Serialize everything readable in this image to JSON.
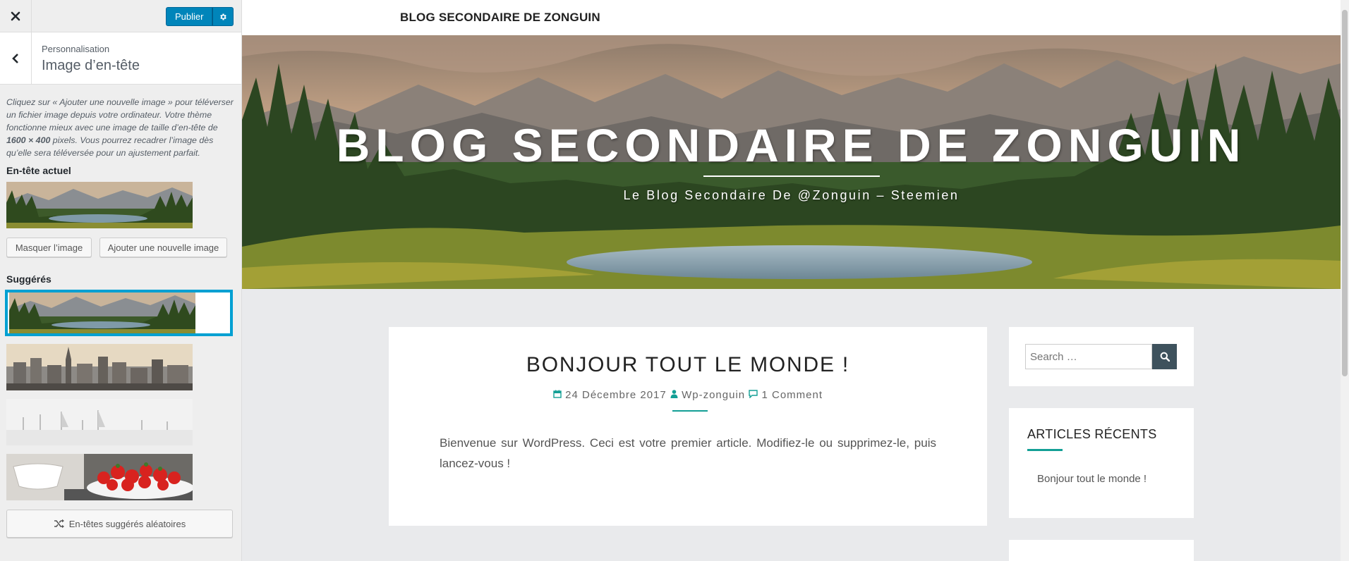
{
  "customizer": {
    "close_icon": "close-icon",
    "publish_label": "Publier",
    "settings_icon": "gear-icon",
    "back_icon": "chevron-left-icon",
    "breadcrumb": "Personnalisation",
    "section_title": "Image d’en-tête",
    "help_text_1": "Cliquez sur « Ajouter une nouvelle image » pour téléverser un fichier image depuis votre ordinateur. Votre thème fonctionne mieux avec une image de taille d’en-tête de ",
    "help_text_bold": "1600 × 400",
    "help_text_2": " pixels. Vous pourrez recadrer l’image dès qu’elle sera téléversée pour un ajustement parfait.",
    "current_header_label": "En-tête actuel",
    "hide_image_label": "Masquer l’image",
    "add_image_label": "Ajouter une nouvelle image",
    "suggested_label": "Suggérés",
    "random_label": "En-têtes suggérés aléatoires",
    "random_icon": "shuffle-icon",
    "accent_color": "#0085ba",
    "selection_color": "#00a0d2"
  },
  "site": {
    "topbar_title": "BLOG SECONDAIRE DE ZONGUIN",
    "hero_title": "BLOG SECONDAIRE DE ZONGUIN",
    "hero_tagline": "Le Blog Secondaire De @Zonguin – Steemien",
    "accent_color": "#139f95"
  },
  "post": {
    "title": "BONJOUR TOUT LE MONDE !",
    "date": "24 Décembre 2017",
    "author": "Wp-zonguin",
    "comments": "1 Comment",
    "body": "Bienvenue sur WordPress. Ceci est votre premier article. Modifiez-le ou supprimez-le, puis lancez-vous !"
  },
  "sidebar": {
    "search_placeholder": "Search …",
    "search_icon": "search-icon",
    "recent_title": "ARTICLES RÉCENTS",
    "recent_items": [
      "Bonjour tout le monde !"
    ]
  }
}
